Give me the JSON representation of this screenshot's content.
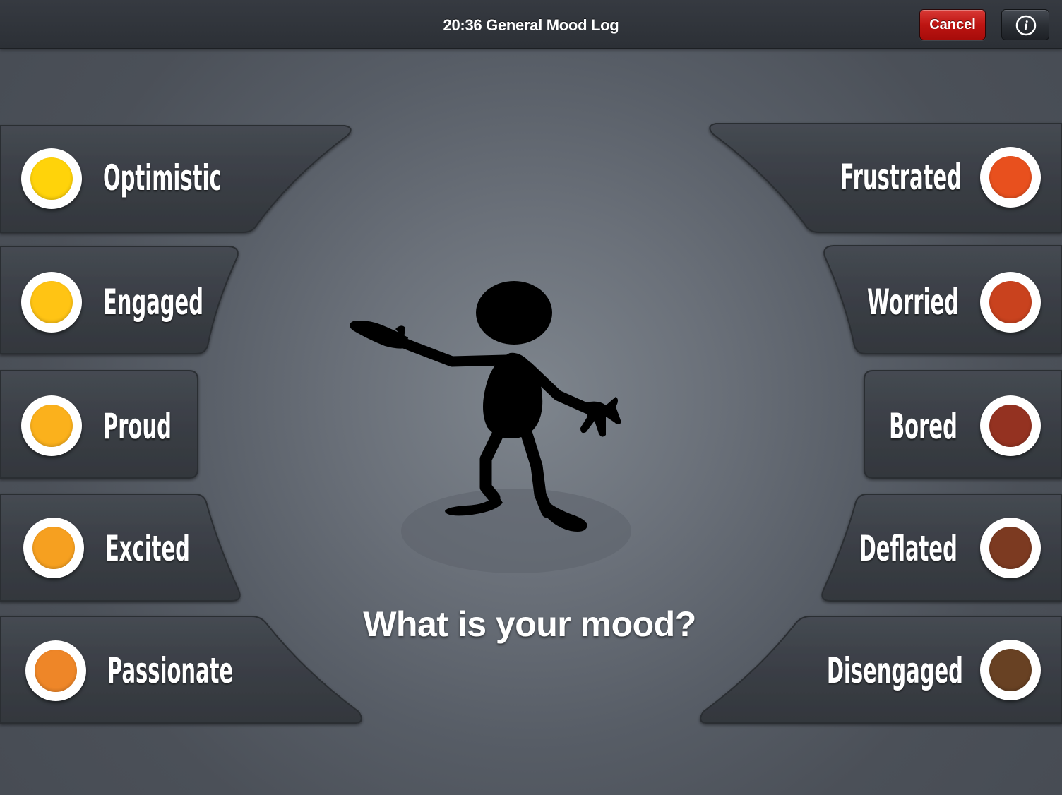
{
  "nav": {
    "title": "20:36 General Mood Log",
    "cancel_label": "Cancel",
    "info_icon": "info-icon"
  },
  "prompt": "What is your mood?",
  "moods": {
    "left": [
      {
        "label": "Optimistic",
        "color": "#FFD30A"
      },
      {
        "label": "Engaged",
        "color": "#FFC414"
      },
      {
        "label": "Proud",
        "color": "#FBB11C"
      },
      {
        "label": "Excited",
        "color": "#F6A020"
      },
      {
        "label": "Passionate",
        "color": "#EE8628"
      }
    ],
    "right": [
      {
        "label": "Frustrated",
        "color": "#E8501E"
      },
      {
        "label": "Worried",
        "color": "#C9421E"
      },
      {
        "label": "Bored",
        "color": "#943221"
      },
      {
        "label": "Deflated",
        "color": "#7C3A21"
      },
      {
        "label": "Disengaged",
        "color": "#684123"
      }
    ]
  },
  "figure_icon": "stick-figure-icon"
}
